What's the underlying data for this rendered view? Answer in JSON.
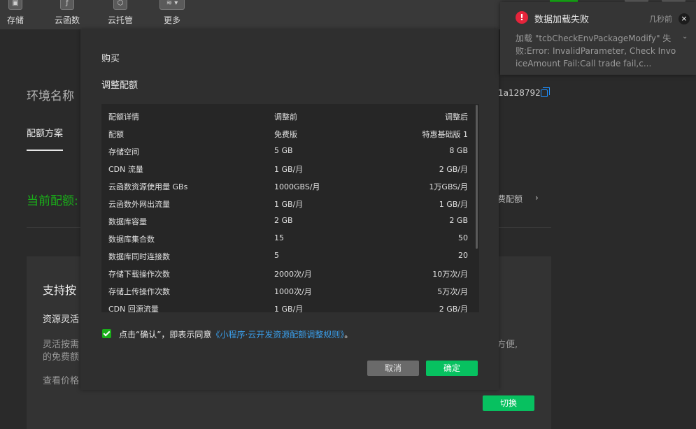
{
  "toolbar": {
    "items": [
      {
        "label": "存储",
        "icon": "save-icon"
      },
      {
        "label": "云函数",
        "icon": "function-icon"
      },
      {
        "label": "云托管",
        "icon": "container-icon"
      },
      {
        "label": "更多",
        "icon": "layers-icon"
      }
    ]
  },
  "page": {
    "env_title": "环境名称",
    "env_id": "1a128792",
    "quota_tab": "配额方案",
    "current_quota": "当前配额:",
    "paid_quota_link": "费配额",
    "card_title": "支持按",
    "card_sub": "资源灵活",
    "card_desc_line1": "灵活按需",
    "card_desc_line2": "的免费额",
    "card_desc_right": "方便,",
    "card_price": "查看价格",
    "switch_button": "切换"
  },
  "modal": {
    "buy_label": "购买",
    "adjust_label": "调整配额",
    "table": {
      "headers": [
        "配额详情",
        "调整前",
        "调整后"
      ],
      "rows": [
        [
          "配额",
          "免费版",
          "特惠基础版 1"
        ],
        [
          "存储空间",
          "5 GB",
          "8 GB"
        ],
        [
          "CDN 流量",
          "1 GB/月",
          "2 GB/月"
        ],
        [
          "云函数资源使用量 GBs",
          "1000GBS/月",
          "1万GBS/月"
        ],
        [
          "云函数外网出流量",
          "1 GB/月",
          "1 GB/月"
        ],
        [
          "数据库容量",
          "2 GB",
          "2 GB"
        ],
        [
          "数据库集合数",
          "15",
          "50"
        ],
        [
          "数据库同时连接数",
          "5",
          "20"
        ],
        [
          "存储下载操作次数",
          "2000次/月",
          "10万次/月"
        ],
        [
          "存储上传操作次数",
          "1000次/月",
          "5万次/月"
        ],
        [
          "CDN 回源流量",
          "1 GB/月",
          "2 GB/月"
        ]
      ]
    },
    "agree_prefix": "点击“确认”，即表示同意",
    "agree_link": "《小程序·云开发资源配额调整规则》",
    "agree_suffix": "。",
    "agree_checked": true,
    "cancel_button": "取消",
    "confirm_button": "确定"
  },
  "notification": {
    "title": "数据加载失败",
    "time": "几秒前",
    "close_glyph": "×",
    "expand_glyph": "⌄",
    "error_glyph": "!",
    "message": "加载 \"tcbCheckEnvPackageModify\" 失败:Error: InvalidParameter, Check InvoiceAmount Fail:Call trade fail,c..."
  },
  "colors": {
    "accent_green": "#07c160",
    "link_blue": "#3a9eea",
    "error_red": "#e5243b"
  }
}
